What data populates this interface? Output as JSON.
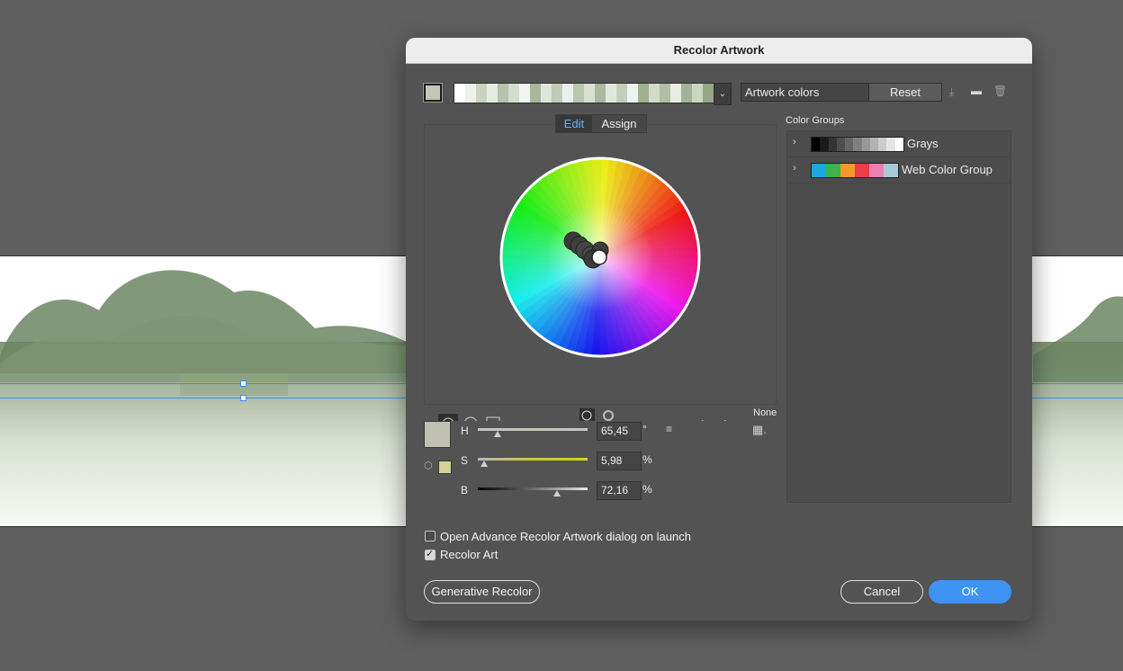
{
  "window": {
    "title": "Recolor Artwork"
  },
  "toolbar": {
    "artwork_field": "Artwork colors",
    "reset_label": "Reset",
    "strip_colors": [
      "#ffffff",
      "#eef2ea",
      "#c8d4c0",
      "#e6ebe1",
      "#b5c4ab",
      "#d5ddce",
      "#f2f4ef",
      "#a8b79c",
      "#dfe5d8",
      "#c0ccb6",
      "#edf0e9",
      "#b9c7ae",
      "#d9e0d2",
      "#aab99f",
      "#e3e8dd",
      "#c5d0bb",
      "#f0f3ec",
      "#9fb093",
      "#d2dac9",
      "#b0be a4",
      "#e8ece3",
      "#a1b295",
      "#cbd5c2",
      "#94a886"
    ]
  },
  "tabs": [
    {
      "label": "Edit"
    },
    {
      "label": "Assign"
    }
  ],
  "color_groups": {
    "heading": "Color Groups",
    "groups": [
      {
        "name": "Grays",
        "colors": [
          "#000000",
          "#1a1a1a",
          "#333333",
          "#4d4d4d",
          "#666666",
          "#808080",
          "#999999",
          "#b3b3b3",
          "#cccccc",
          "#e6e6e6",
          "#ffffff"
        ]
      },
      {
        "name": "Web Color Group",
        "colors": [
          "#1aa7e0",
          "#3db34a",
          "#f39a2b",
          "#ee3d4a",
          "#ef7fb2",
          "#a9c9d6"
        ]
      }
    ]
  },
  "hsb": {
    "h_label": "H",
    "h_value": "65,45",
    "h_unit": "°",
    "s_label": "S",
    "s_value": "5,98",
    "s_unit": "%",
    "b_label": "B",
    "b_value": "72,16",
    "b_unit": "%",
    "h_level": 0.18,
    "s_level": 0.06,
    "b_level": 0.72
  },
  "none_label": "None",
  "options": [
    {
      "label": "Open Advance Recolor Artwork dialog on launch",
      "checked": false
    },
    {
      "label": "Recolor Art",
      "checked": true
    }
  ],
  "buttons": {
    "generative": "Generative Recolor",
    "cancel": "Cancel",
    "ok": "OK"
  },
  "colors": {
    "accent": "#3f93f2",
    "selected_color": "#c0c0b3"
  }
}
